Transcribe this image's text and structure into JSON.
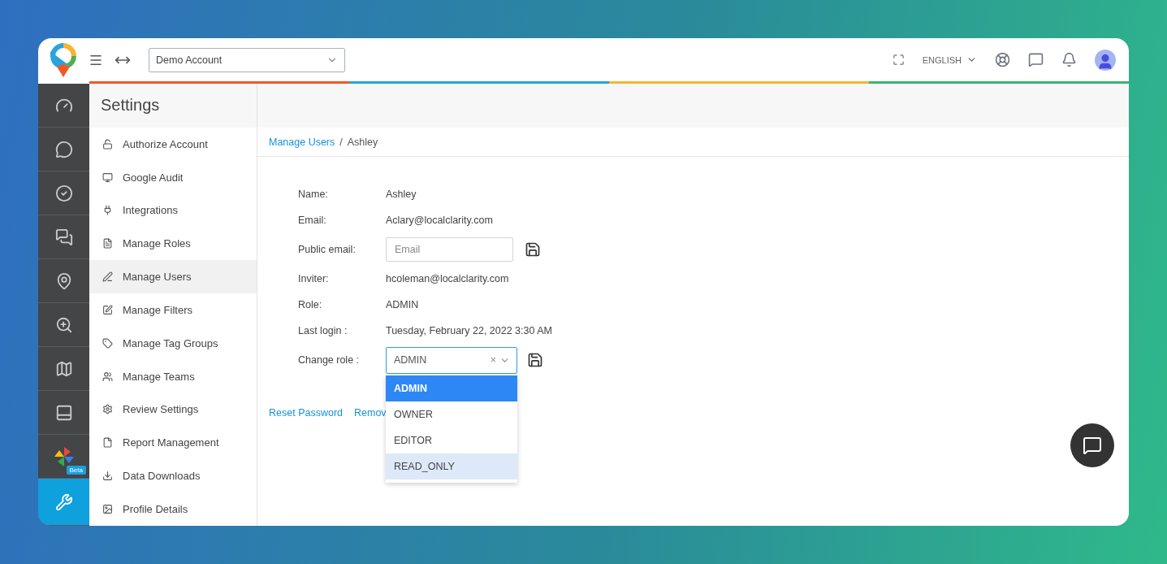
{
  "header": {
    "account_select": {
      "value": "Demo Account"
    },
    "language": "ENGLISH"
  },
  "rail": [
    {
      "selected": false
    },
    {
      "selected": false
    },
    {
      "selected": false
    },
    {
      "selected": false
    },
    {
      "selected": false
    },
    {
      "selected": false
    },
    {
      "selected": false
    },
    {
      "selected": false
    },
    {
      "selected": false,
      "badge": "Beta"
    },
    {
      "selected": true
    }
  ],
  "settings": {
    "title": "Settings",
    "items": [
      {
        "label": "Authorize Account",
        "selected": false
      },
      {
        "label": "Google Audit",
        "selected": false
      },
      {
        "label": "Integrations",
        "selected": false
      },
      {
        "label": "Manage Roles",
        "selected": false
      },
      {
        "label": "Manage Users",
        "selected": true
      },
      {
        "label": "Manage Filters",
        "selected": false
      },
      {
        "label": "Manage Tag Groups",
        "selected": false
      },
      {
        "label": "Manage Teams",
        "selected": false
      },
      {
        "label": "Review Settings",
        "selected": false
      },
      {
        "label": "Report Management",
        "selected": false
      },
      {
        "label": "Data Downloads",
        "selected": false
      },
      {
        "label": "Profile Details",
        "selected": false
      }
    ]
  },
  "breadcrumb": {
    "link": "Manage Users",
    "separator": "/",
    "current": "Ashley"
  },
  "details": [
    {
      "kind": "text",
      "label": "Name:",
      "value": "Ashley"
    },
    {
      "kind": "text",
      "label": "Email:",
      "value": "Aclary@localclarity.com"
    },
    {
      "kind": "input",
      "label": "Public email:",
      "placeholder": "Email"
    },
    {
      "kind": "text",
      "label": "Inviter:",
      "value": "hcoleman@localclarity.com"
    },
    {
      "kind": "text",
      "label": "Role:",
      "value": "ADMIN"
    },
    {
      "kind": "text",
      "label": "Last login :",
      "value": "Tuesday, February 22, 2022 3:30 AM"
    },
    {
      "kind": "select",
      "label": "Change role :",
      "value": "ADMIN",
      "clear": "×",
      "options": [
        {
          "label": "ADMIN",
          "selected": true,
          "highlighted": false
        },
        {
          "label": "OWNER",
          "selected": false,
          "highlighted": false
        },
        {
          "label": "EDITOR",
          "selected": false,
          "highlighted": false
        },
        {
          "label": "READ_ONLY",
          "selected": false,
          "highlighted": true
        }
      ]
    }
  ],
  "actions": [
    "Reset Password",
    "Remov"
  ]
}
